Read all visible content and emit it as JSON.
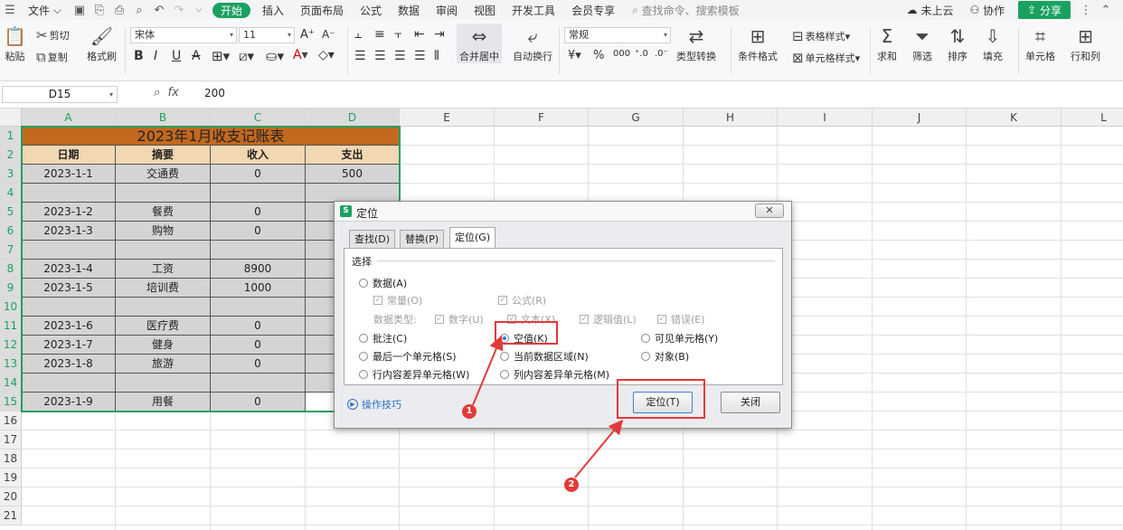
{
  "menubar": {
    "file_label": "文件",
    "tabs": [
      {
        "label": "开始",
        "active": true
      },
      {
        "label": "插入"
      },
      {
        "label": "页面布局"
      },
      {
        "label": "公式"
      },
      {
        "label": "数据"
      },
      {
        "label": "审阅"
      },
      {
        "label": "视图"
      },
      {
        "label": "开发工具"
      },
      {
        "label": "会员专享"
      }
    ],
    "search_placeholder": "查找命令、搜索模板",
    "cloud_label": "未上云",
    "collab_label": "协作",
    "share_label": "分享"
  },
  "ribbon": {
    "paste": "粘贴",
    "cut": "剪切",
    "copy": "复制",
    "format_painter": "格式刷",
    "font_name": "宋体",
    "font_size": "11",
    "merge_center": "合并居中",
    "wrap_text": "自动换行",
    "number_format": "常规",
    "type_convert": "类型转换",
    "conditional_format": "条件格式",
    "table_style": "表格样式",
    "cell_style": "单元格样式",
    "sum": "求和",
    "filter": "筛选",
    "sort": "排序",
    "fill": "填充",
    "cell": "单元格",
    "row_col": "行和列"
  },
  "formula_bar": {
    "name_box": "D15",
    "fx_label": "fx",
    "value": "200"
  },
  "sheet": {
    "columns": [
      "A",
      "B",
      "C",
      "D",
      "E",
      "F",
      "G",
      "H",
      "I",
      "J",
      "K",
      "L"
    ],
    "rows": [
      "1",
      "2",
      "3",
      "4",
      "5",
      "6",
      "7",
      "8",
      "9",
      "10",
      "11",
      "12",
      "13",
      "14",
      "15",
      "16",
      "17",
      "18",
      "19",
      "20",
      "21"
    ],
    "title": "2023年1月收支记账表",
    "headers": [
      "日期",
      "摘要",
      "收入",
      "支出"
    ],
    "data": [
      [
        "2023-1-1",
        "交通费",
        "0",
        "500"
      ],
      [
        "",
        "",
        "",
        ""
      ],
      [
        "2023-1-2",
        "餐费",
        "0",
        ""
      ],
      [
        "2023-1-3",
        "购物",
        "0",
        ""
      ],
      [
        "",
        "",
        "",
        ""
      ],
      [
        "2023-1-4",
        "工资",
        "8900",
        ""
      ],
      [
        "2023-1-5",
        "培训费",
        "1000",
        ""
      ],
      [
        "",
        "",
        "",
        ""
      ],
      [
        "2023-1-6",
        "医疗费",
        "0",
        ""
      ],
      [
        "2023-1-7",
        "健身",
        "0",
        ""
      ],
      [
        "2023-1-8",
        "旅游",
        "0",
        ""
      ],
      [
        "",
        "",
        "",
        ""
      ],
      [
        "2023-1-9",
        "用餐",
        "0",
        ""
      ]
    ]
  },
  "dialog": {
    "title": "定位",
    "close_symbol": "✕",
    "tabs": [
      "查找(D)",
      "替换(P)",
      "定位(G)"
    ],
    "group_label": "选择",
    "opt_data": "数据(A)",
    "opt_constant": "常量(O)",
    "opt_formula": "公式(R)",
    "data_type_label": "数据类型:",
    "opt_number": "数字(U)",
    "opt_text": "文本(X)",
    "opt_logic": "逻辑值(L)",
    "opt_error": "错误(E)",
    "opt_comment": "批注(C)",
    "opt_blank": "空值(K)",
    "opt_visible": "可见单元格(Y)",
    "opt_last_cell": "最后一个单元格(S)",
    "opt_current_region": "当前数据区域(N)",
    "opt_object": "对象(B)",
    "opt_row_diff": "行内容差异单元格(W)",
    "opt_col_diff": "列内容差异单元格(M)",
    "tip_label": "操作技巧",
    "locate_button": "定位(T)",
    "close_button": "关闭"
  },
  "annotations": {
    "badge_1": "1",
    "badge_2": "2"
  },
  "colors": {
    "accent": "#1aa160",
    "title_fill": "#c2691f",
    "header_fill": "#f2d8b2",
    "body_fill": "#d4d4d4",
    "annotation_red": "#e23a3a"
  }
}
